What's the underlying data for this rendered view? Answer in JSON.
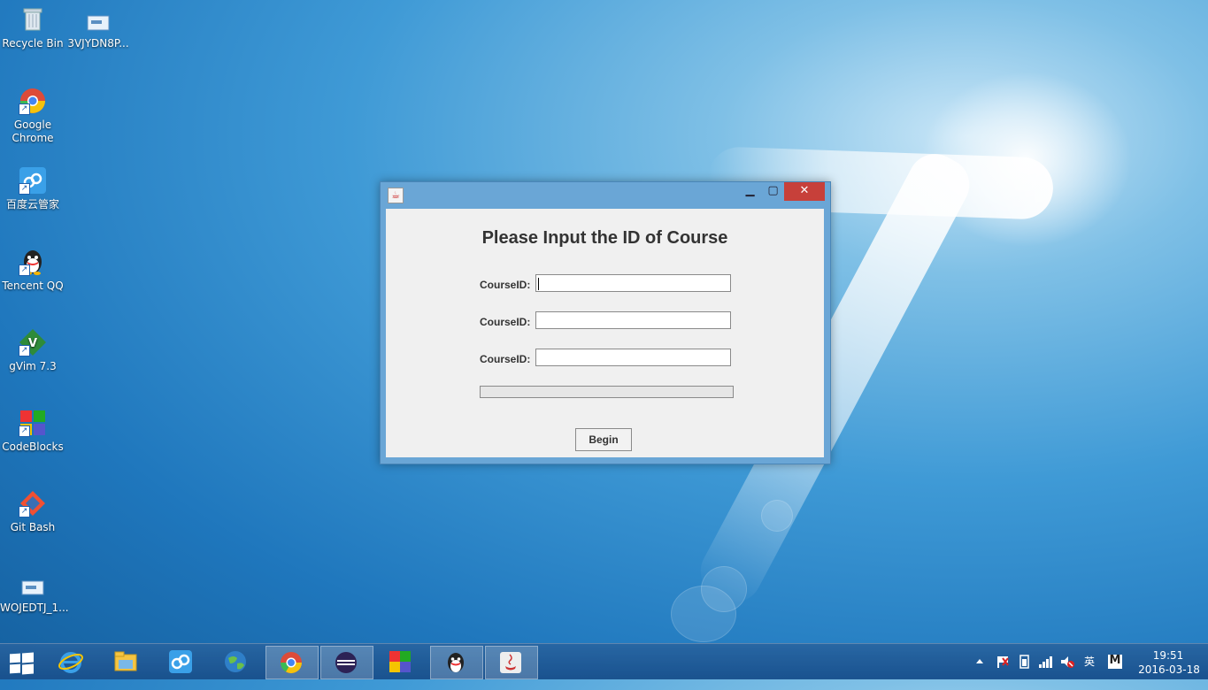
{
  "desktop": {
    "icons": [
      {
        "label": "Recycle Bin"
      },
      {
        "label": "3VJYDN8P..."
      },
      {
        "label": "Google Chrome"
      },
      {
        "label": "百度云管家"
      },
      {
        "label": "Tencent QQ"
      },
      {
        "label": "gVim 7.3"
      },
      {
        "label": "CodeBlocks"
      },
      {
        "label": "Git Bash"
      },
      {
        "label": "WOJEDTJ_1..."
      }
    ]
  },
  "window": {
    "java_icon": "java-icon",
    "minimize_glyph": "▁",
    "maximize_glyph": "▢",
    "close_glyph": "✕",
    "title": "Please Input the ID of Course",
    "fields": [
      {
        "label": "CourseID:",
        "value": ""
      },
      {
        "label": "CourseID:",
        "value": ""
      },
      {
        "label": "CourseID:",
        "value": ""
      }
    ],
    "progress": 0,
    "begin_label": "Begin"
  },
  "taskbar": {
    "apps": [
      {
        "name": "internet-explorer-icon"
      },
      {
        "name": "file-explorer-icon"
      },
      {
        "name": "baidu-cloud-icon"
      },
      {
        "name": "globe-icon"
      },
      {
        "name": "chrome-icon"
      },
      {
        "name": "eclipse-icon"
      },
      {
        "name": "codeblocks-icon"
      },
      {
        "name": "qq-icon"
      },
      {
        "name": "java-icon"
      }
    ],
    "tray": {
      "ime_label": "英",
      "ime_mode": "M"
    },
    "clock": {
      "time": "19:51",
      "date": "2016-03-18"
    }
  }
}
